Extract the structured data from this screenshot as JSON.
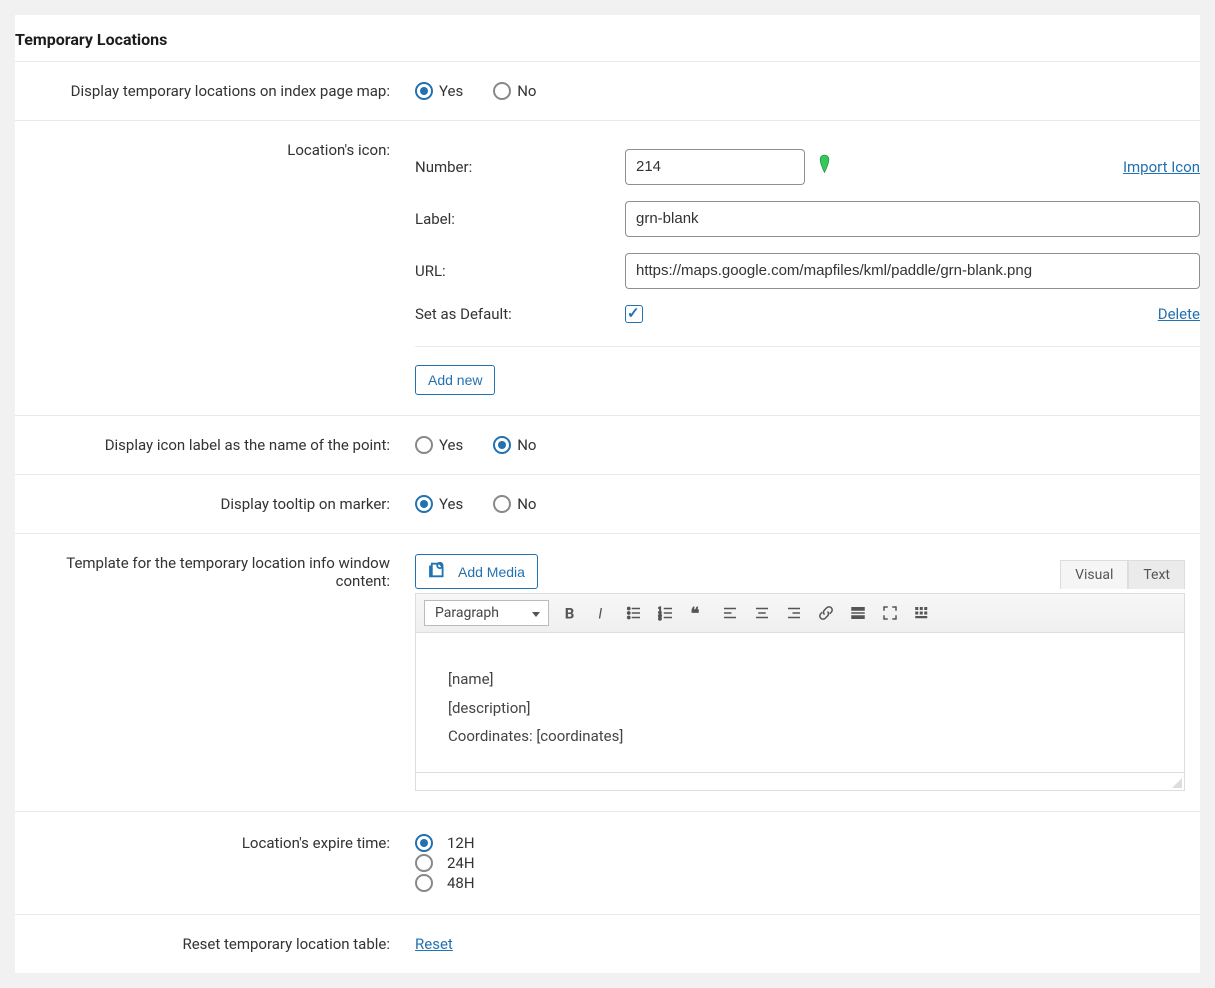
{
  "sectionTitle": "Temporary Locations",
  "yes": "Yes",
  "no": "No",
  "labels": {
    "displayOnIndex": "Display temporary locations on index page map:",
    "locationsIcon": "Location's icon:",
    "displayIconLabel": "Display icon label as the name of the point:",
    "displayTooltip": "Display tooltip on marker:",
    "templateInfo": "Template for the temporary location info window content:",
    "expireTime": "Location's expire time:",
    "resetTable": "Reset temporary location table:"
  },
  "iconForm": {
    "numberLabel": "Number:",
    "numberValue": "214",
    "importIcon": "Import Icon",
    "labelLabel": "Label:",
    "labelValue": "grn-blank",
    "urlLabel": "URL:",
    "urlValue": "https://maps.google.com/mapfiles/kml/paddle/grn-blank.png",
    "setDefaultLabel": "Set as Default:",
    "deleteLink": "Delete",
    "addNew": "Add new"
  },
  "editor": {
    "addMedia": "Add Media",
    "tabVisual": "Visual",
    "tabText": "Text",
    "formatSelect": "Paragraph",
    "content1": "[name]",
    "content2": "[description]",
    "content3": "Coordinates: [coordinates]"
  },
  "expireOptions": {
    "h12": "12H",
    "h24": "24H",
    "h48": "48H"
  },
  "resetLink": "Reset"
}
